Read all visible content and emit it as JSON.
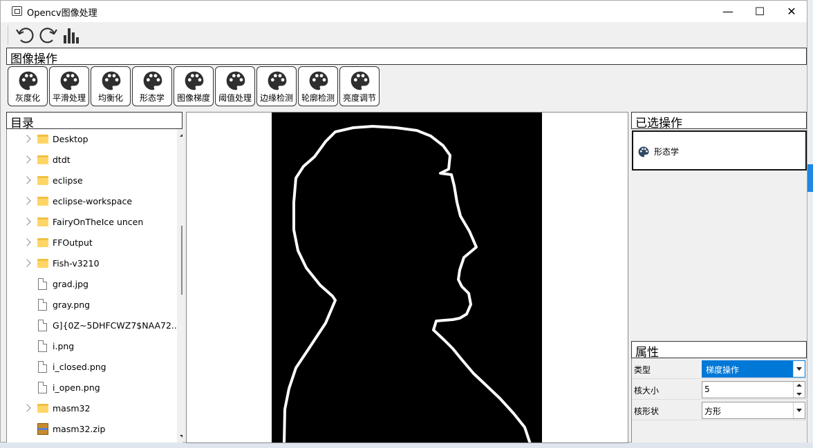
{
  "window": {
    "title": "Opencv图像处理",
    "controls": {
      "minimize": "—",
      "maximize": "☐",
      "close": "✕"
    }
  },
  "toolbar": {
    "buttons": [
      {
        "name": "undo-icon"
      },
      {
        "name": "redo-icon"
      },
      {
        "name": "histogram-icon"
      }
    ]
  },
  "operations": {
    "header": "图像操作",
    "items": [
      {
        "label": "灰度化"
      },
      {
        "label": "平滑处理"
      },
      {
        "label": "均衡化"
      },
      {
        "label": "形态学"
      },
      {
        "label": "图像梯度"
      },
      {
        "label": "阈值处理"
      },
      {
        "label": "边缘检测"
      },
      {
        "label": "轮廓检测"
      },
      {
        "label": "亮度调节"
      }
    ]
  },
  "directory": {
    "header": "目录",
    "items": [
      {
        "kind": "folder",
        "expandable": true,
        "name": "Desktop"
      },
      {
        "kind": "folder",
        "expandable": true,
        "name": "dtdt"
      },
      {
        "kind": "folder",
        "expandable": true,
        "name": "eclipse"
      },
      {
        "kind": "folder",
        "expandable": true,
        "name": "eclipse-workspace"
      },
      {
        "kind": "folder",
        "expandable": true,
        "name": "FairyOnTheIce uncen"
      },
      {
        "kind": "folder",
        "expandable": true,
        "name": "FFOutput"
      },
      {
        "kind": "folder",
        "expandable": true,
        "name": "Fish-v3210"
      },
      {
        "kind": "file",
        "expandable": false,
        "name": "grad.jpg"
      },
      {
        "kind": "file",
        "expandable": false,
        "name": "gray.png"
      },
      {
        "kind": "file",
        "expandable": false,
        "name": "G]{0Z~5DHFCWZ7$NAA72..."
      },
      {
        "kind": "file",
        "expandable": false,
        "name": "i.png"
      },
      {
        "kind": "file",
        "expandable": false,
        "name": "i_closed.png"
      },
      {
        "kind": "file",
        "expandable": false,
        "name": "i_open.png"
      },
      {
        "kind": "folder",
        "expandable": true,
        "name": "masm32"
      },
      {
        "kind": "zip",
        "expandable": false,
        "name": "masm32.zip"
      }
    ]
  },
  "selected_ops": {
    "header": "已选操作",
    "items": [
      {
        "label": "形态学"
      }
    ]
  },
  "properties": {
    "header": "属性",
    "rows": [
      {
        "label": "类型",
        "value": "梯度操作",
        "control": "dropdown"
      },
      {
        "label": "核大小",
        "value": "5",
        "control": "spinbox"
      },
      {
        "label": "核形状",
        "value": "方形",
        "control": "dropdown"
      }
    ]
  },
  "colors": {
    "accent": "#0078d7",
    "canvas_bg": "#000000",
    "contour": "#ffffff"
  }
}
